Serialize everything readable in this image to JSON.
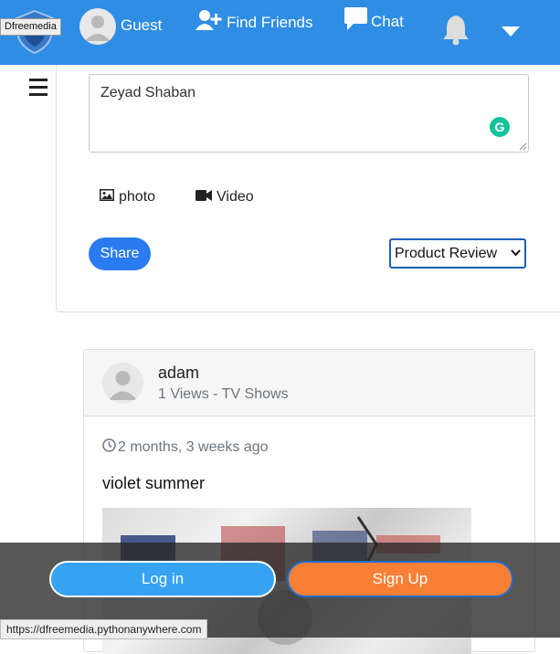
{
  "brand": {
    "tooltip": "Dfreemedia",
    "primary_color": "#2f8de4"
  },
  "nav": {
    "user_label": "Guest",
    "find_friends_label": "Find Friends",
    "chat_label": "Chat",
    "icons": [
      "logo-shield-icon",
      "user-avatar-icon",
      "user-plus-icon",
      "chat-bubble-icon",
      "bell-icon",
      "caret-down-icon"
    ]
  },
  "sidebar": {
    "menu_icon": "hamburger-icon"
  },
  "composer": {
    "text_value": "Zeyad Shaban",
    "grammarly_label": "G",
    "photo_label": "photo",
    "video_label": "Video",
    "share_label": "Share",
    "post_type_selected": "Product Review"
  },
  "post": {
    "author": "adam",
    "meta": "1 Views - TV Shows",
    "time_ago": "2 months, 3 weeks ago",
    "title": "violet summer"
  },
  "auth": {
    "login_label": "Log in",
    "signup_label": "Sign Up",
    "login_color": "#36a2f2",
    "signup_color": "#f77f36"
  },
  "status_bar": {
    "url": "https://dfreemedia.pythonanywhere.com"
  }
}
